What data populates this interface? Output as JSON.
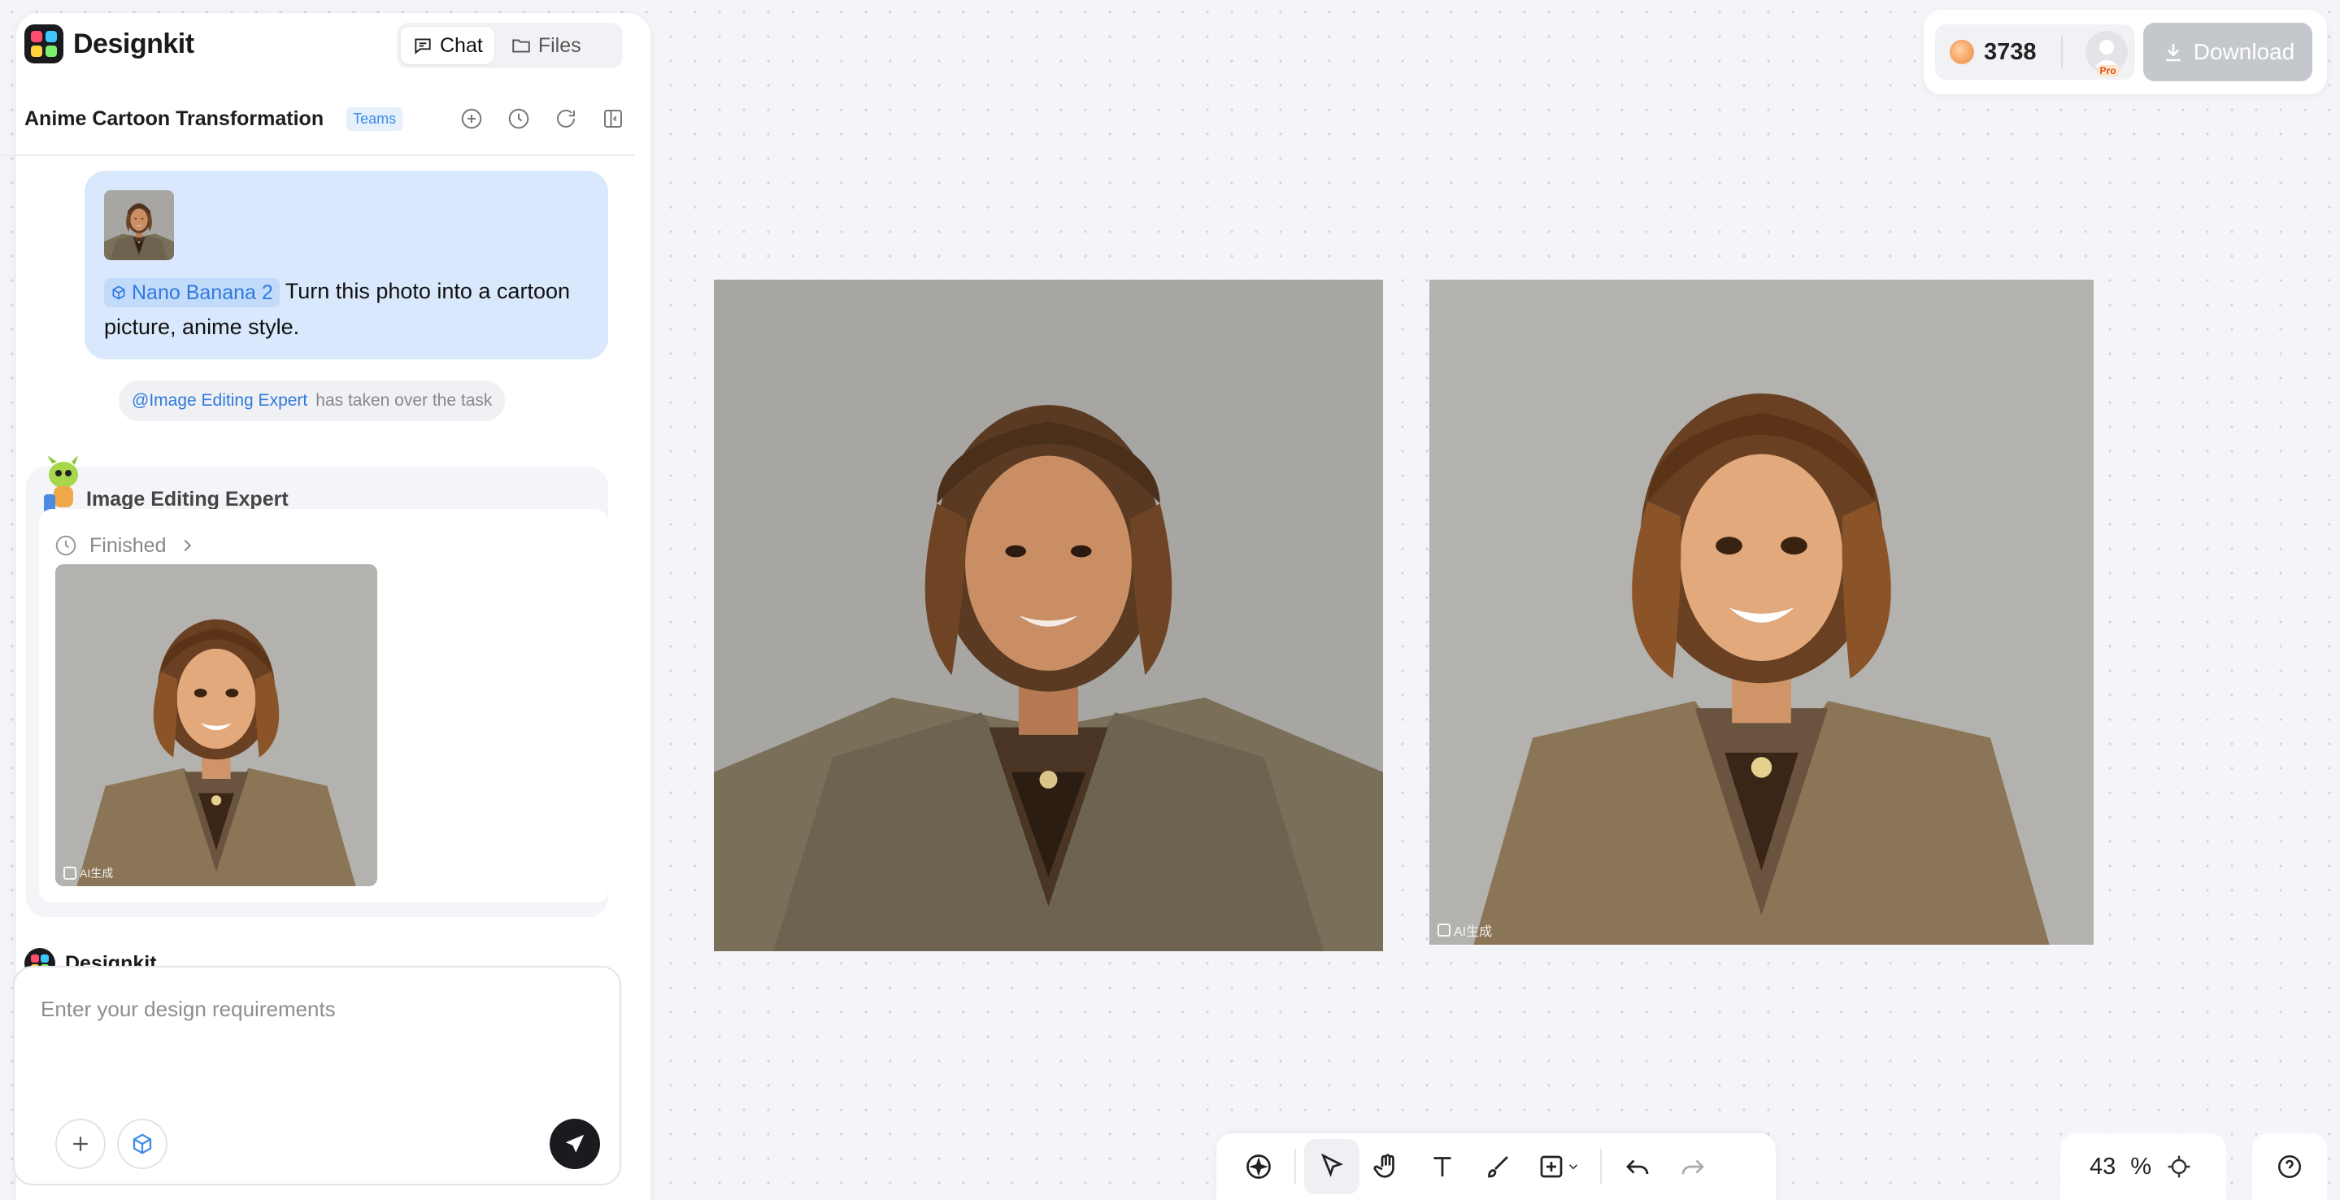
{
  "app": {
    "name": "Designkit"
  },
  "header": {
    "tabs": [
      {
        "label": "Chat",
        "icon": "chat-bubble-icon",
        "active": true
      },
      {
        "label": "Files",
        "icon": "folder-icon",
        "active": false
      }
    ],
    "title": "Anime Cartoon Transformation",
    "badge": "Teams",
    "tools": [
      "new-chat-icon",
      "history-icon",
      "refresh-icon",
      "collapse-panel-icon"
    ]
  },
  "chat": {
    "user_message": {
      "model_chip": "Nano Banana 2",
      "text": "Turn this photo into a cartoon picture, anime style."
    },
    "handoff": {
      "agent": "@Image Editing Expert",
      "text": "has taken over the task"
    },
    "expert": {
      "name": "Image Editing Expert",
      "status": "Finished"
    },
    "ai_watermark": "AI生成",
    "designkit_label": "Designkit"
  },
  "composer": {
    "placeholder": "Enter your design requirements"
  },
  "topbar": {
    "credits": "3738",
    "plan_badge": "Pro",
    "download_label": "Download"
  },
  "canvas": {
    "tools": [
      "add-element-icon",
      "select-pointer-icon",
      "hand-pan-icon",
      "text-icon",
      "brush-icon",
      "insert-frame-icon",
      "undo-icon",
      "redo-icon"
    ],
    "zoom_value": "43",
    "zoom_unit": "%"
  },
  "colors": {
    "accent": "#2f79de",
    "bubble": "#d9e8fc",
    "canvas_bg": "#f4f5f9",
    "dark": "#1b1b1f"
  }
}
